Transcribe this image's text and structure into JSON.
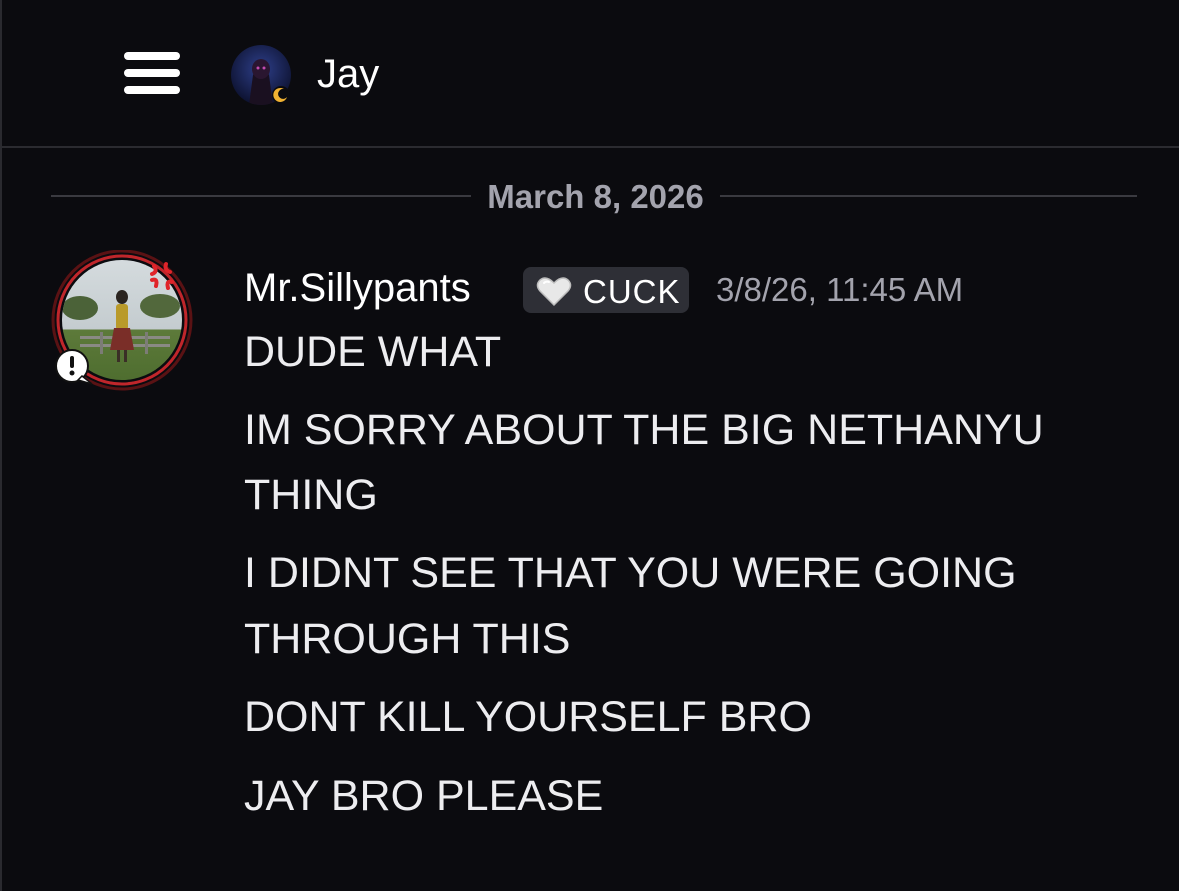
{
  "header": {
    "menu_icon": "hamburger-menu-icon",
    "channel_name": "Jay"
  },
  "date_divider": "March 8, 2026",
  "message": {
    "username": "Mr.Sillypants",
    "badge_icon": "white-heart-icon",
    "badge_text": "CUCK",
    "timestamp": "3/8/26, 11:45 AM",
    "lines": [
      "DUDE WHAT",
      "IM SORRY ABOUT THE BIG NETHANYU",
      "THING",
      "I DIDNT SEE THAT YOU WERE GOING",
      "THROUGH THIS",
      "DONT KILL YOURSELF BRO",
      "JAY BRO PLEASE"
    ]
  },
  "colors": {
    "background": "#0b0b0f",
    "divider": "#2b2b30",
    "muted_text": "#a3a3ad",
    "badge_bg": "#2e2f36",
    "avatar_ring": "#c0262b"
  }
}
